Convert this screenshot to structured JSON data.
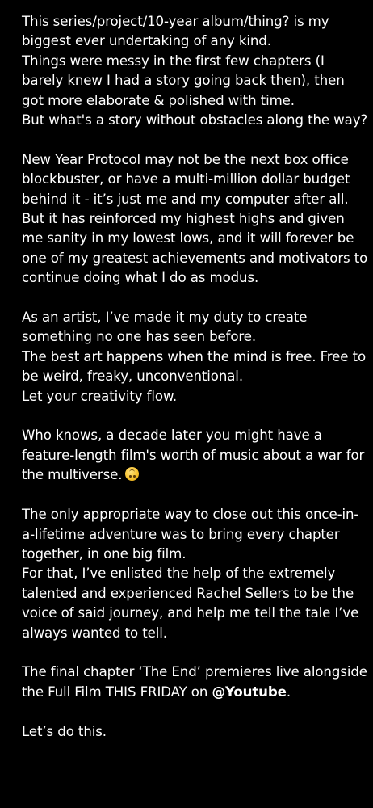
{
  "post": {
    "p1": [
      "This series/project/10-year album/thing? is my biggest ever undertaking of any kind.",
      "Things were messy in the first few chapters (I barely knew I had a story going back then), then got more elaborate & polished with time.",
      "But what's a story without obstacles along the way?"
    ],
    "p2": [
      "New Year Protocol may not be the next box office blockbuster, or have a multi-million dollar budget behind it - it’s just me and my computer after all.",
      "But it has reinforced my highest highs and given me sanity in my lowest lows, and it will forever be one of my greatest achievements and motivators to continue doing what I do as modus."
    ],
    "p3": [
      "As an artist, I’ve made it my duty to create something no one has seen before.",
      "The best art happens when the mind is free. Free to be weird, freaky, unconventional.",
      "Let your creativity flow."
    ],
    "p4": "Who knows, a decade later you might have a feature-length film's worth of music about a war for the multiverse.",
    "p4_emoji": "upside-down-face-emoji-icon",
    "p5": [
      "The only appropriate way to close out this once-in-a-lifetime adventure was to bring every chapter together, in one big film.",
      "For that, I’ve enlisted the help of the extremely talented and experienced Rachel Sellers to be the voice of said journey, and help me tell the tale I’ve always wanted to tell."
    ],
    "p6_text": "The final chapter ‘The End’ premieres live alongside the Full Film THIS FRIDAY on",
    "p6_mention": "@Youtube",
    "p6_end": ".",
    "p7": "Let’s do this."
  },
  "colors": {
    "background": "#000000",
    "text": "#ffffff"
  }
}
